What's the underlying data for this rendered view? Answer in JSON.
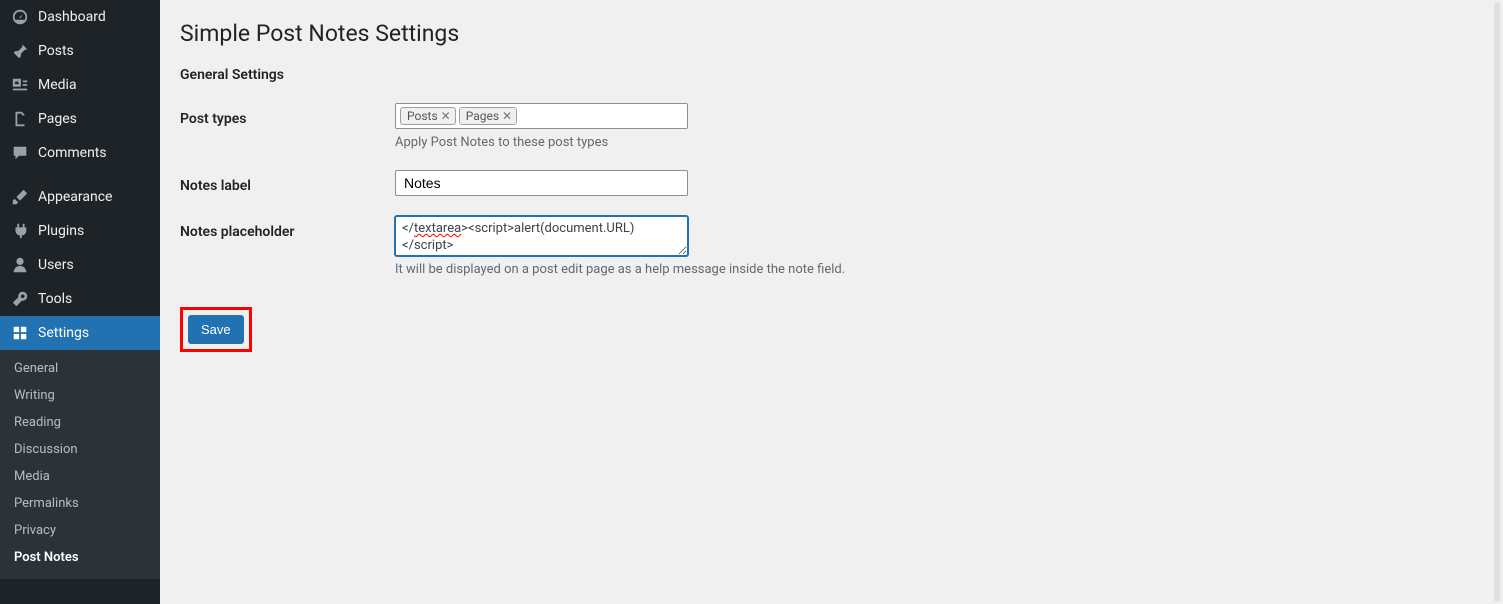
{
  "sidebar": {
    "items": [
      {
        "label": "Dashboard",
        "icon": "dashboard-icon"
      },
      {
        "label": "Posts",
        "icon": "pin-icon"
      },
      {
        "label": "Media",
        "icon": "media-icon"
      },
      {
        "label": "Pages",
        "icon": "pages-icon"
      },
      {
        "label": "Comments",
        "icon": "comments-icon"
      },
      {
        "label": "Appearance",
        "icon": "brush-icon"
      },
      {
        "label": "Plugins",
        "icon": "plug-icon"
      },
      {
        "label": "Users",
        "icon": "users-icon"
      },
      {
        "label": "Tools",
        "icon": "tools-icon"
      },
      {
        "label": "Settings",
        "icon": "settings-icon"
      }
    ],
    "submenu": [
      {
        "label": "General"
      },
      {
        "label": "Writing"
      },
      {
        "label": "Reading"
      },
      {
        "label": "Discussion"
      },
      {
        "label": "Media"
      },
      {
        "label": "Permalinks"
      },
      {
        "label": "Privacy"
      },
      {
        "label": "Post Notes"
      }
    ]
  },
  "main": {
    "page_title": "Simple Post Notes Settings",
    "section_title": "General Settings",
    "post_types": {
      "label": "Post types",
      "tags": [
        "Posts",
        "Pages"
      ],
      "description": "Apply Post Notes to these post types"
    },
    "notes_label": {
      "label": "Notes label",
      "value": "Notes"
    },
    "notes_placeholder": {
      "label": "Notes placeholder",
      "value_prefix": "</",
      "value_misspell": "textarea",
      "value_suffix": "><script>alert(document.URL)\n</scr",
      "value_end": "ipt>",
      "description": "It will be displayed on a post edit page as a help message inside the note field."
    },
    "save_label": "Save"
  }
}
